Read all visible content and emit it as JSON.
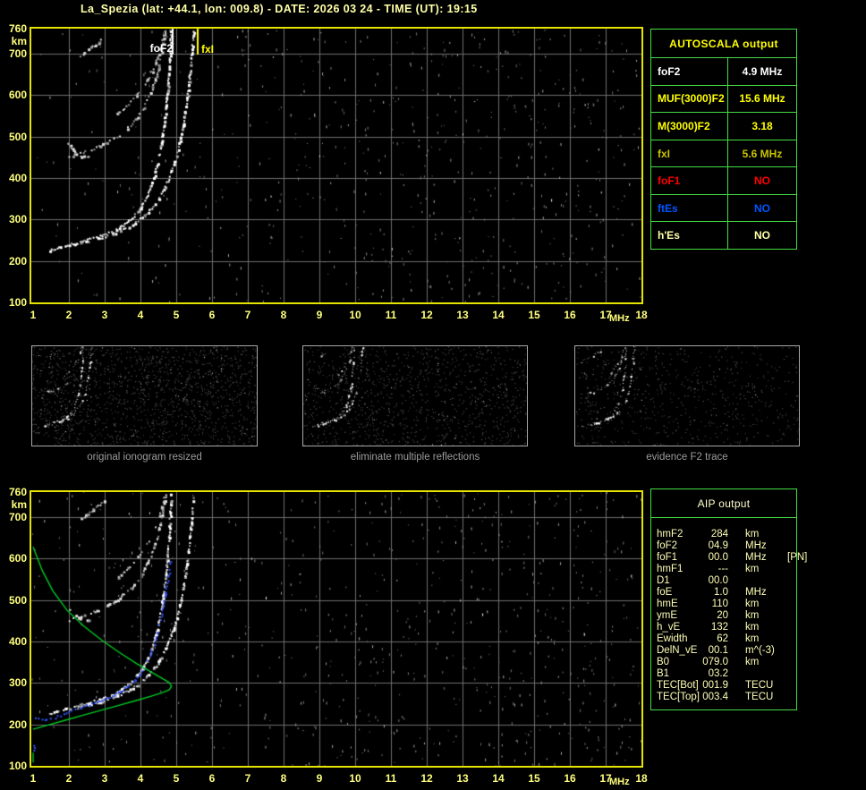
{
  "title": "La_Spezia (lat: +44.1, lon: 009.8) - DATE: 2026 03 24 - TIME (UT): 19:15",
  "colors": {
    "background": "#000000",
    "title_text": "#ffffa8",
    "axis_text": "#ffff7d",
    "plot_border": "#e4e400",
    "grid": "#6e6e6e",
    "table_border": "#44dd44",
    "caption_gray": "#9c9c9c",
    "profile_green": "#00cc22",
    "restored_blue": "#3355ff"
  },
  "autoscala_table": {
    "header": "AUTOSCALA output",
    "rows": [
      {
        "param": "foF2",
        "value": "4.9 MHz",
        "color": "#ffffff"
      },
      {
        "param": "MUF(3000)F2",
        "value": "15.6 MHz",
        "color": "#ffff00"
      },
      {
        "param": "M(3000)F2",
        "value": "3.18",
        "color": "#ffff00"
      },
      {
        "param": "fxI",
        "value": "5.6 MHz",
        "color": "#c8c400"
      },
      {
        "param": "foF1",
        "value": "NO",
        "color": "#ff0000"
      },
      {
        "param": "ftEs",
        "value": "NO",
        "color": "#0055ff"
      },
      {
        "param": "h'Es",
        "value": "NO",
        "color": "#ffffaa"
      }
    ]
  },
  "aip_table": {
    "header": "AIP output",
    "rows": [
      {
        "param": "hmF2",
        "value": "284",
        "unit": "km",
        "extra": ""
      },
      {
        "param": "foF2",
        "value": "04.9",
        "unit": "MHz",
        "extra": ""
      },
      {
        "param": "foF1",
        "value": "00.0",
        "unit": "MHz",
        "extra": "[PN]"
      },
      {
        "param": "hmF1",
        "value": "---",
        "unit": "km",
        "extra": ""
      },
      {
        "param": "D1",
        "value": "00.0",
        "unit": "",
        "extra": ""
      },
      {
        "param": "foE",
        "value": "1.0",
        "unit": "MHz",
        "extra": ""
      },
      {
        "param": "hmE",
        "value": "110",
        "unit": "km",
        "extra": ""
      },
      {
        "param": "ymE",
        "value": "20",
        "unit": "km",
        "extra": ""
      },
      {
        "param": "h_vE",
        "value": "132",
        "unit": "km",
        "extra": ""
      },
      {
        "param": "Ewidth",
        "value": "62",
        "unit": "km",
        "extra": ""
      },
      {
        "param": "DelN_vE",
        "value": "00.1",
        "unit": "m^(-3)",
        "extra": ""
      },
      {
        "param": "B0",
        "value": "079.0",
        "unit": "km",
        "extra": ""
      },
      {
        "param": "B1",
        "value": "03.2",
        "unit": "",
        "extra": ""
      },
      {
        "param": "TEC[Bot]",
        "value": "001.9",
        "unit": "TECU",
        "extra": ""
      },
      {
        "param": "TEC[Top]",
        "value": "003.4",
        "unit": "TECU",
        "extra": ""
      }
    ]
  },
  "thumbnails": [
    {
      "caption": "original ionogram resized"
    },
    {
      "caption": "eliminate multiple reflections"
    },
    {
      "caption": "evidence F2 trace"
    }
  ],
  "chart_data": [
    {
      "type": "scatter",
      "title": "recorded ionogram",
      "xlabel": "MHz",
      "ylabel": "km",
      "xlim": [
        1,
        18
      ],
      "ylim": [
        100,
        760
      ],
      "xticks": [
        1,
        2,
        3,
        4,
        5,
        6,
        7,
        8,
        9,
        10,
        11,
        12,
        13,
        14,
        15,
        16,
        17,
        18
      ],
      "yticks": [
        760,
        700,
        600,
        500,
        400,
        300,
        200,
        100
      ],
      "grid": true,
      "markers": [
        {
          "label": "foF2",
          "f": 4.9,
          "color": "#ffffff"
        },
        {
          "label": "fxI",
          "f": 5.6,
          "color": "#ffff00"
        }
      ],
      "traces": [
        {
          "name": "F2-ordinary-trace",
          "color": "white",
          "size": 2,
          "gap": 0.22,
          "points": [
            [
              1.45,
              228
            ],
            [
              1.9,
              238
            ],
            [
              2.4,
              250
            ],
            [
              2.9,
              262
            ],
            [
              3.3,
              277
            ],
            [
              3.7,
              300
            ],
            [
              4.0,
              330
            ],
            [
              4.25,
              372
            ],
            [
              4.45,
              430
            ],
            [
              4.6,
              500
            ],
            [
              4.7,
              570
            ],
            [
              4.78,
              650
            ],
            [
              4.84,
              756
            ]
          ]
        },
        {
          "name": "F2-extraordinary-trace",
          "color": "white",
          "size": 2,
          "gap": 0.3,
          "points": [
            [
              2.15,
              240
            ],
            [
              2.7,
              252
            ],
            [
              3.2,
              266
            ],
            [
              3.7,
              285
            ],
            [
              4.1,
              310
            ],
            [
              4.45,
              345
            ],
            [
              4.75,
              395
            ],
            [
              5.0,
              455
            ],
            [
              5.18,
              530
            ],
            [
              5.32,
              615
            ],
            [
              5.42,
              700
            ],
            [
              5.47,
              756
            ]
          ]
        },
        {
          "name": "second-hop-ordinary",
          "color": "#dddddd",
          "size": 2,
          "gap": 0.45,
          "points": [
            [
              1.95,
              452
            ],
            [
              2.4,
              463
            ],
            [
              2.9,
              480
            ],
            [
              3.35,
              502
            ],
            [
              3.75,
              532
            ],
            [
              4.05,
              568
            ],
            [
              4.3,
              612
            ],
            [
              4.5,
              668
            ],
            [
              4.62,
              725
            ],
            [
              4.7,
              756
            ]
          ]
        },
        {
          "name": "second-hop-extraordinary",
          "color": "#cccccc",
          "size": 2,
          "gap": 0.55,
          "points": [
            [
              3.35,
              556
            ],
            [
              3.75,
              588
            ],
            [
              4.1,
              625
            ],
            [
              4.4,
              675
            ],
            [
              4.58,
              724
            ],
            [
              4.68,
              756
            ]
          ]
        },
        {
          "name": "second-hop-fragment",
          "color": "#dddddd",
          "size": 2,
          "gap": 0.4,
          "points": [
            [
              1.95,
              485
            ],
            [
              2.15,
              465
            ],
            [
              2.35,
              452
            ],
            [
              2.6,
              456
            ]
          ]
        },
        {
          "name": "third-hop-fragment",
          "color": "#dddddd",
          "size": 2,
          "gap": 0.4,
          "points": [
            [
              2.3,
              695
            ],
            [
              2.65,
              718
            ],
            [
              3.0,
              742
            ]
          ]
        }
      ]
    },
    {
      "type": "scatter",
      "title": "restored ionogram with AUTOSCALA trace and electron density profile",
      "xlabel": "MHz",
      "ylabel": "km",
      "xlim": [
        1,
        18
      ],
      "ylim": [
        100,
        760
      ],
      "xticks": [
        1,
        2,
        3,
        4,
        5,
        6,
        7,
        8,
        9,
        10,
        11,
        12,
        13,
        14,
        15,
        16,
        17,
        18
      ],
      "yticks": [
        760,
        700,
        600,
        500,
        400,
        300,
        200,
        100
      ],
      "grid": true,
      "markers": [],
      "traces": [
        {
          "name": "F2-ordinary-trace",
          "color": "white",
          "size": 2,
          "gap": 0.22,
          "points": [
            [
              1.45,
              228
            ],
            [
              1.9,
              238
            ],
            [
              2.4,
              250
            ],
            [
              2.9,
              262
            ],
            [
              3.3,
              277
            ],
            [
              3.7,
              300
            ],
            [
              4.0,
              330
            ],
            [
              4.25,
              372
            ],
            [
              4.45,
              430
            ],
            [
              4.6,
              500
            ],
            [
              4.7,
              570
            ],
            [
              4.78,
              650
            ],
            [
              4.84,
              756
            ]
          ]
        },
        {
          "name": "F2-extraordinary-trace",
          "color": "white",
          "size": 2,
          "gap": 0.3,
          "points": [
            [
              2.15,
              240
            ],
            [
              2.7,
              252
            ],
            [
              3.2,
              266
            ],
            [
              3.7,
              285
            ],
            [
              4.1,
              310
            ],
            [
              4.45,
              345
            ],
            [
              4.75,
              395
            ],
            [
              5.0,
              455
            ],
            [
              5.18,
              530
            ],
            [
              5.32,
              615
            ],
            [
              5.42,
              700
            ],
            [
              5.47,
              756
            ]
          ]
        },
        {
          "name": "second-hop-ordinary",
          "color": "#dddddd",
          "size": 2,
          "gap": 0.45,
          "points": [
            [
              1.95,
              452
            ],
            [
              2.4,
              463
            ],
            [
              2.9,
              480
            ],
            [
              3.35,
              502
            ],
            [
              3.75,
              532
            ],
            [
              4.05,
              568
            ],
            [
              4.3,
              612
            ],
            [
              4.5,
              668
            ],
            [
              4.62,
              725
            ],
            [
              4.7,
              756
            ]
          ]
        },
        {
          "name": "second-hop-extraordinary",
          "color": "#cccccc",
          "size": 2,
          "gap": 0.55,
          "points": [
            [
              3.35,
              556
            ],
            [
              3.75,
              588
            ],
            [
              4.1,
              625
            ],
            [
              4.4,
              675
            ],
            [
              4.58,
              724
            ],
            [
              4.68,
              756
            ]
          ]
        },
        {
          "name": "second-hop-fragment",
          "color": "#dddddd",
          "size": 2,
          "gap": 0.4,
          "points": [
            [
              1.95,
              485
            ],
            [
              2.15,
              465
            ],
            [
              2.35,
              452
            ],
            [
              2.6,
              456
            ]
          ]
        },
        {
          "name": "third-hop-fragment",
          "color": "#dddddd",
          "size": 2,
          "gap": 0.4,
          "points": [
            [
              2.3,
              695
            ],
            [
              2.65,
              718
            ],
            [
              3.0,
              742
            ]
          ]
        }
      ],
      "restored_trace": {
        "name": "autoscala-restored-trace",
        "color": "#3355ff",
        "size": 2,
        "gap": 0.25,
        "segments": [
          [
            [
              1.05,
              218
            ],
            [
              1.3,
              212
            ],
            [
              1.6,
              218
            ],
            [
              2.0,
              232
            ],
            [
              2.5,
              247
            ],
            [
              3.0,
              262
            ],
            [
              3.45,
              280
            ],
            [
              3.85,
              308
            ],
            [
              4.15,
              348
            ],
            [
              4.4,
              400
            ],
            [
              4.55,
              455
            ],
            [
              4.68,
              515
            ],
            [
              4.78,
              560
            ],
            [
              4.84,
              595
            ]
          ],
          [
            [
              1.03,
              138
            ],
            [
              1.03,
              152
            ]
          ]
        ]
      },
      "profile": {
        "name": "electron-density-profile",
        "color": "#00cc22",
        "hmF2_km": 284,
        "foF2_MHz": 4.9,
        "segments": [
          [
            [
              1.0,
              628
            ],
            [
              1.25,
              572
            ],
            [
              1.55,
              522
            ],
            [
              1.95,
              475
            ],
            [
              2.4,
              438
            ],
            [
              2.9,
              404
            ],
            [
              3.4,
              374
            ],
            [
              3.9,
              346
            ],
            [
              4.3,
              326
            ],
            [
              4.6,
              311
            ],
            [
              4.8,
              301
            ],
            [
              4.87,
              292
            ],
            [
              4.8,
              283
            ],
            [
              4.6,
              276
            ],
            [
              4.3,
              268
            ],
            [
              3.9,
              258
            ],
            [
              3.4,
              246
            ],
            [
              2.9,
              234
            ],
            [
              2.4,
              222
            ],
            [
              1.9,
              210
            ],
            [
              1.4,
              198
            ],
            [
              1.0,
              188
            ]
          ],
          [
            [
              1.0,
              132
            ],
            [
              1.0,
              108
            ]
          ]
        ]
      }
    }
  ]
}
